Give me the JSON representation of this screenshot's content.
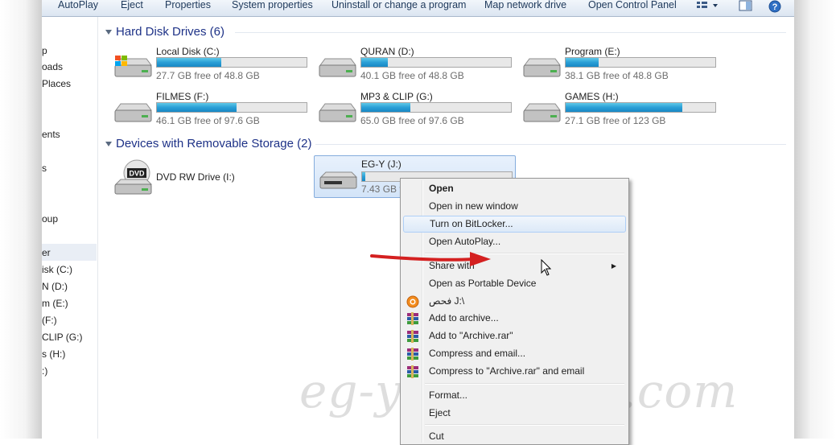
{
  "toolbar": {
    "buttons": [
      "AutoPlay",
      "Eject",
      "Properties",
      "System properties",
      "Uninstall or change a program",
      "Map network drive",
      "Open Control Panel"
    ]
  },
  "nav": {
    "items": [
      "p",
      "oads",
      "Places",
      "ents",
      "s",
      "oup",
      "er",
      "isk (C:)",
      "N (D:)",
      "m (E:)",
      "(F:)",
      "CLIP (G:)",
      "s (H:)",
      ":)"
    ]
  },
  "groups": {
    "hdd_title": "Hard Disk Drives (6)",
    "removable_title": "Devices with Removable Storage (2)"
  },
  "drives": [
    {
      "name": "Local Disk (C:)",
      "free": "27.7 GB free of 48.8 GB",
      "used_fraction": 0.43
    },
    {
      "name": "QURAN (D:)",
      "free": "40.1 GB free of 48.8 GB",
      "used_fraction": 0.18
    },
    {
      "name": "Program (E:)",
      "free": "38.1 GB free of 48.8 GB",
      "used_fraction": 0.22
    },
    {
      "name": "FILMES (F:)",
      "free": "46.1 GB free of 97.6 GB",
      "used_fraction": 0.53
    },
    {
      "name": "MP3 & CLIP (G:)",
      "free": "65.0 GB free of 97.6 GB",
      "used_fraction": 0.33
    },
    {
      "name": "GAMES (H:)",
      "free": "27.1 GB free of 123 GB",
      "used_fraction": 0.78
    }
  ],
  "removable": [
    {
      "name": "DVD RW Drive (I:)",
      "icon_label": "DVD"
    },
    {
      "name": "EG-Y (J:)",
      "free": "7.43 GB fre",
      "used_fraction": 0.02
    }
  ],
  "context_menu": {
    "items": [
      {
        "label": "Open",
        "bold": true
      },
      {
        "label": "Open in new window"
      },
      {
        "label": "Turn on BitLocker..."
      },
      {
        "label": "Open AutoPlay..."
      },
      {
        "label": "Share with",
        "submenu": true
      },
      {
        "label": "Open as Portable Device"
      },
      {
        "label": "فحص J:\\"
      },
      {
        "label": "Add to archive..."
      },
      {
        "label": "Add to \"Archive.rar\""
      },
      {
        "label": "Compress and email..."
      },
      {
        "label": "Compress to \"Archive.rar\" and email"
      },
      {
        "label": "Format..."
      },
      {
        "label": "Eject"
      },
      {
        "label": "Cut"
      }
    ]
  },
  "watermark": "eg-y.blogspot.com",
  "colors": {
    "group_heading": "#1e3287",
    "bar_fill": "#2a9fd6",
    "menu_hover": "#dce9f8",
    "arrow": "#d42020"
  }
}
